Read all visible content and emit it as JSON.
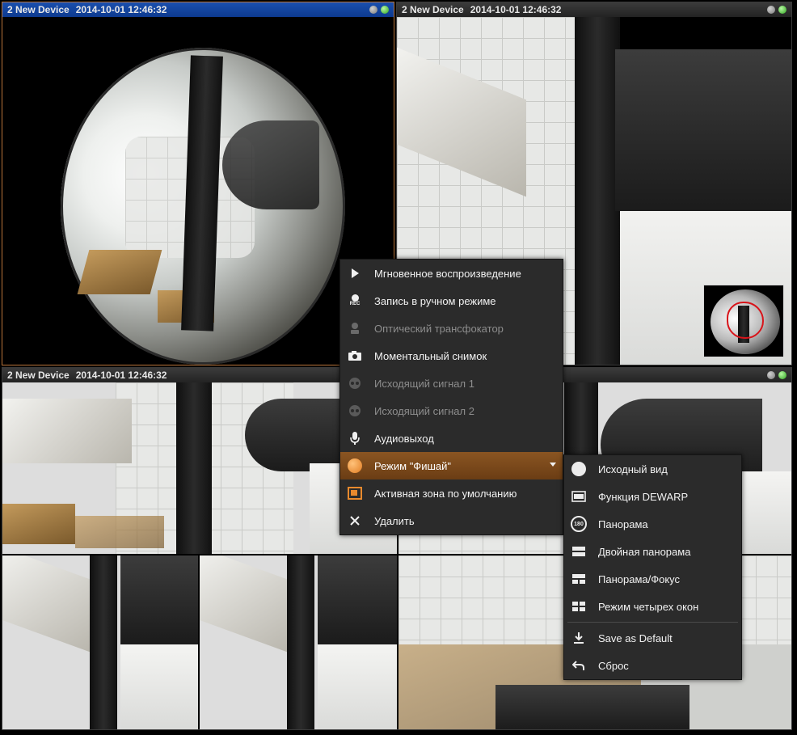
{
  "panes": [
    {
      "device": "2 New Device",
      "timestamp": "2014-10-01 12:46:32"
    },
    {
      "device": "2 New Device",
      "timestamp": "2014-10-01 12:46:32"
    },
    {
      "device": "2 New Device",
      "timestamp": "2014-10-01 12:46:32"
    }
  ],
  "status_colors": {
    "active": "#2fa51f",
    "inactive": "#9a9a9a",
    "selected_border": "#b8743a"
  },
  "context_menu": {
    "items": [
      {
        "label": "Мгновенное воспроизведение",
        "icon": "play-icon",
        "enabled": true
      },
      {
        "label": "Запись в ручном режиме",
        "icon": "record-icon",
        "icon_text": "REC",
        "enabled": true
      },
      {
        "label": "Оптический трансфокатор",
        "icon": "optical-zoom-icon",
        "enabled": false
      },
      {
        "label": "Моментальный снимок",
        "icon": "camera-icon",
        "enabled": true
      },
      {
        "label": "Исходящий сигнал 1",
        "icon": "output-signal-icon",
        "enabled": false
      },
      {
        "label": "Исходящий сигнал 2",
        "icon": "output-signal-icon",
        "enabled": false
      },
      {
        "label": "Аудиовыход",
        "icon": "microphone-icon",
        "enabled": true
      },
      {
        "label": "Режим \"Фишай\"",
        "icon": "fisheye-icon",
        "enabled": true,
        "highlighted": true
      },
      {
        "label": "Активная зона по умолчанию",
        "icon": "active-zone-icon",
        "enabled": true
      },
      {
        "label": "Удалить",
        "icon": "close-icon",
        "enabled": true
      }
    ]
  },
  "fisheye_submenu": {
    "items": [
      {
        "label": "Исходный вид",
        "icon": "circle-icon"
      },
      {
        "label": "Функция DEWARP",
        "icon": "dewarp-icon"
      },
      {
        "label": "Панорама",
        "icon": "panorama-180-icon",
        "icon_text": "180"
      },
      {
        "label": "Двойная панорама",
        "icon": "double-panorama-icon"
      },
      {
        "label": "Панорама/Фокус",
        "icon": "panorama-focus-icon"
      },
      {
        "label": "Режим четырех окон",
        "icon": "quad-view-icon"
      }
    ],
    "extra": [
      {
        "label": "Save as Default",
        "icon": "download-icon"
      },
      {
        "label": "Сброс",
        "icon": "undo-icon"
      }
    ]
  }
}
